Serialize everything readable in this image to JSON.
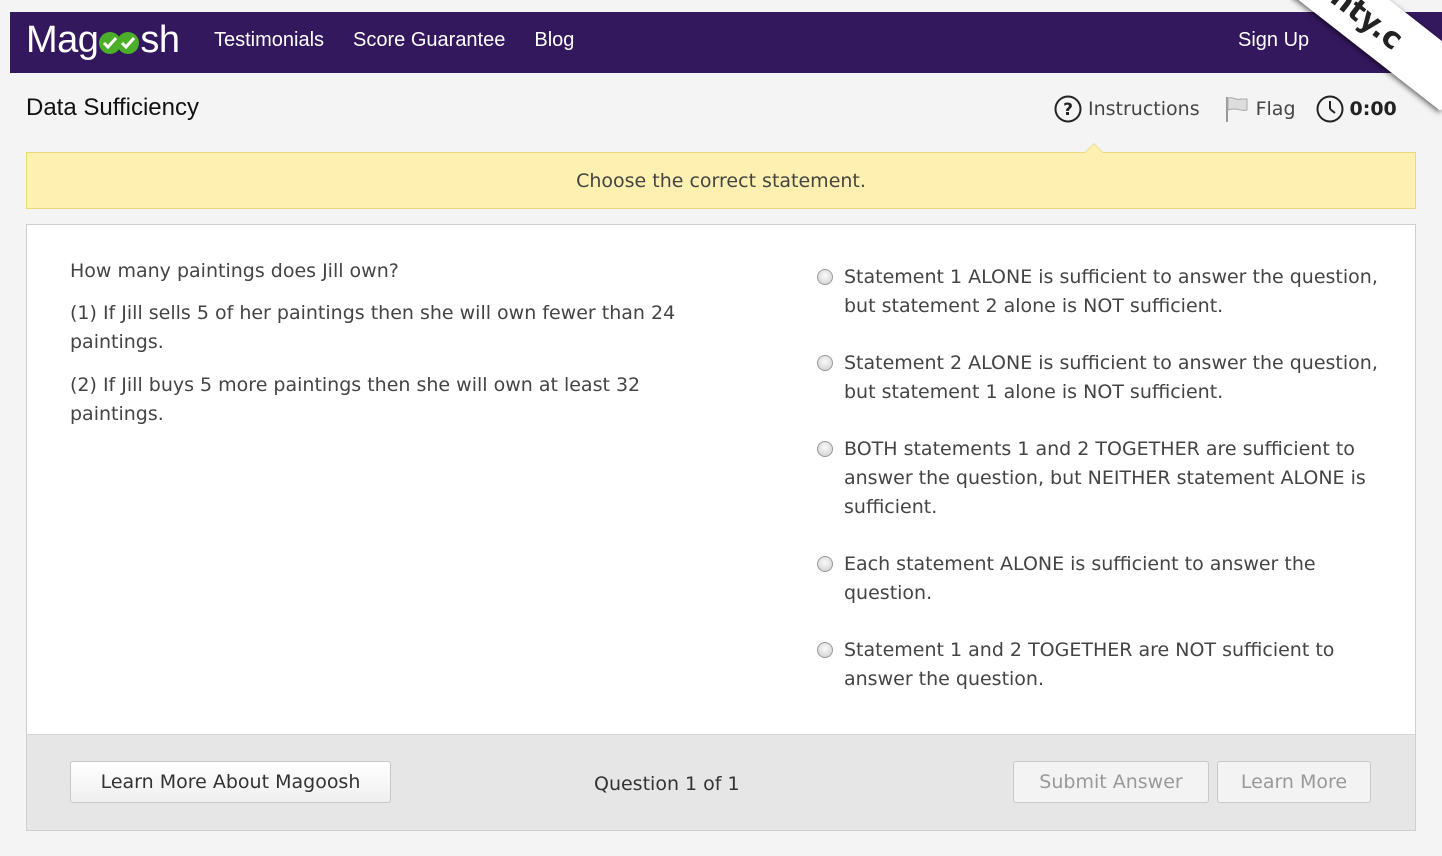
{
  "nav": {
    "logo_prefix": "Mag",
    "logo_suffix": "sh",
    "links": [
      "Testimonials",
      "Score Guarantee",
      "Blog"
    ],
    "signup_label": "Sign Up",
    "ribbon_text": "nty.c"
  },
  "header": {
    "title": "Data Sufficiency",
    "instructions_label": "Instructions",
    "flag_label": "Flag",
    "timer": "0:00"
  },
  "banner": {
    "text": "Choose the correct statement."
  },
  "question": {
    "prompt": "How many paintings does Jill own?",
    "statement1": "(1) If Jill sells 5 of her paintings then she will own fewer than 24 paintings.",
    "statement2": "(2) If Jill buys 5 more paintings then she will own at least 32 paintings."
  },
  "answers": [
    "Statement 1 ALONE is sufficient to answer the question, but statement 2 alone is NOT sufficient.",
    "Statement 2 ALONE is sufficient to answer the question, but statement 1 alone is NOT sufficient.",
    "BOTH statements 1 and 2 TOGETHER are sufficient to answer the question, but NEITHER statement ALONE is sufficient.",
    "Each statement ALONE is sufficient to answer the question.",
    "Statement 1 and 2 TOGETHER are NOT sufficient to answer the question."
  ],
  "footer": {
    "learn_more_magoosh": "Learn More About Magoosh",
    "question_count": "Question 1 of 1",
    "submit_label": "Submit Answer",
    "learn_more_label": "Learn More"
  },
  "colors": {
    "navbar": "#34185e",
    "logo_check": "#4caf2a",
    "banner_bg": "#fdf0b0"
  }
}
